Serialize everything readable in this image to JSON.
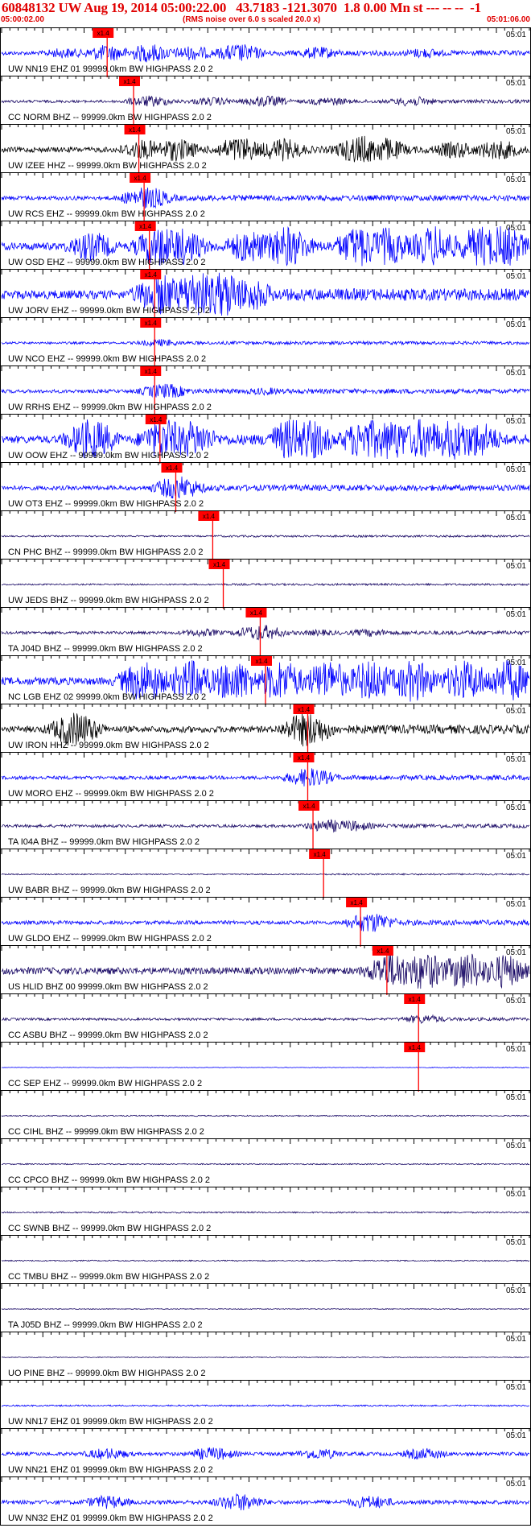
{
  "header": {
    "title": "60848132 UW Aug 19, 2014 05:00:22.00   43.7183 -121.3070  1.8 0.00 Mn st --- -- --  -1",
    "start_time": "05:00:02.00",
    "rms_note": "(RMS noise over 6.0 s scaled 20.0 x)",
    "end_time": "05:01:06.00"
  },
  "colors": {
    "trace_blue": "#0000ff",
    "trace_navy": "#1a0a66",
    "trace_black": "#000000",
    "pick_red": "#ff0000",
    "title_red": "#e00000"
  },
  "chart_data": {
    "type": "seismogram",
    "x_start": "05:00:02.00",
    "x_end": "05:01:06.00",
    "minute_label": "05:01",
    "pick_label": "x1.4",
    "panels": [
      {
        "label": "UW NN19 EHZ 01 99999.0km BW  HIGHPASS  2.0  2",
        "color": "blue",
        "pick": 0.2,
        "env": [
          [
            0.12,
            0.5
          ],
          [
            0.2,
            0.8
          ],
          [
            0.28,
            0.9
          ],
          [
            0.36,
            0.7
          ],
          [
            0.45,
            0.9
          ],
          [
            0.6,
            0.6
          ],
          [
            0.8,
            0.5
          ]
        ],
        "amp": 13
      },
      {
        "label": "CC NORM BHZ -- 99999.0km BW  HIGHPASS  2.0  2",
        "color": "navy",
        "pick": 0.25,
        "env": [
          [
            0.28,
            0.8
          ],
          [
            0.4,
            0.6
          ],
          [
            0.5,
            0.8
          ],
          [
            0.62,
            0.6
          ],
          [
            0.78,
            0.7
          ]
        ],
        "amp": 9
      },
      {
        "label": "UW IZEE HHZ -- 99999.0km BW  HIGHPASS  2.0  2",
        "color": "black",
        "pick": 0.26,
        "env": [
          [
            0.27,
            0.7
          ],
          [
            0.33,
            0.8
          ],
          [
            0.45,
            0.9
          ],
          [
            0.53,
            0.8
          ],
          [
            0.68,
            1.0
          ],
          [
            0.72,
            0.9
          ],
          [
            0.86,
            0.6
          ],
          [
            0.94,
            0.7
          ]
        ],
        "amp": 18
      },
      {
        "label": "UW RCS EHZ -- 99999.0km BW  HIGHPASS  2.0  2",
        "color": "blue",
        "pick": 0.27,
        "env": [
          [
            0.275,
            1.0
          ]
        ],
        "amp": 14
      },
      {
        "label": "UW OSD EHZ -- 99999.0km BW  HIGHPASS  2.0  2",
        "color": "blue",
        "pick": 0.28,
        "env": [
          [
            0.17,
            0.7
          ],
          [
            0.3,
            1.0
          ],
          [
            0.34,
            0.9
          ],
          [
            0.47,
            0.8
          ],
          [
            0.54,
            1.0
          ],
          [
            0.68,
            1.0
          ],
          [
            0.73,
            0.9
          ],
          [
            0.82,
            1.0
          ],
          [
            0.91,
            1.0
          ],
          [
            0.95,
            1.0
          ]
        ],
        "amp": 26
      },
      {
        "label": "UW JORV EHZ -- 99999.0km BW  HIGHPASS  2.0  2",
        "color": "blue",
        "pick": 0.29,
        "env": [
          [
            0.3,
            0.9
          ],
          [
            0.37,
            1.0
          ],
          [
            0.42,
            1.0
          ],
          [
            0.47,
            0.7
          ]
        ],
        "amp": 30
      },
      {
        "label": "UW NCO EHZ -- 99999.0km BW  HIGHPASS  2.0  2",
        "color": "blue",
        "pick": 0.29,
        "env": [
          [
            0.3,
            0.6
          ]
        ],
        "amp": 8
      },
      {
        "label": "UW RRHS EHZ -- 99999.0km BW  HIGHPASS  2.0  2",
        "color": "blue",
        "pick": 0.29,
        "env": [
          [
            0.31,
            0.8
          ],
          [
            0.5,
            0.4
          ]
        ],
        "amp": 12
      },
      {
        "label": "UW OOW EHZ -- 99999.0km BW  HIGHPASS  2.0  2",
        "color": "blue",
        "pick": 0.3,
        "env": [
          [
            0.17,
            1.0
          ],
          [
            0.31,
            1.0
          ],
          [
            0.36,
            0.9
          ],
          [
            0.55,
            1.0
          ],
          [
            0.58,
            1.0
          ],
          [
            0.69,
            1.0
          ],
          [
            0.74,
            1.0
          ],
          [
            0.8,
            1.0
          ],
          [
            0.86,
            1.0
          ],
          [
            0.9,
            0.9
          ]
        ],
        "amp": 26
      },
      {
        "label": "UW OT3 EHZ -- 99999.0km BW  HIGHPASS  2.0  2",
        "color": "blue",
        "pick": 0.33,
        "env": [
          [
            0.335,
            1.0
          ]
        ],
        "amp": 15
      },
      {
        "label": "CN PHC BHZ -- 99999.0km BW  HIGHPASS  2.0  2",
        "color": "navy",
        "pick": 0.4,
        "env": [],
        "amp": 5
      },
      {
        "label": "UW JEDS BHZ -- 99999.0km BW  HIGHPASS  2.0  2",
        "color": "navy",
        "pick": 0.42,
        "env": [],
        "amp": 5
      },
      {
        "label": "TA J04D BHZ -- 99999.0km BW  HIGHPASS  2.0  2",
        "color": "navy",
        "pick": 0.49,
        "env": [
          [
            0.49,
            1.0
          ],
          [
            0.38,
            0.5
          ],
          [
            0.6,
            0.4
          ],
          [
            0.7,
            0.5
          ]
        ],
        "amp": 10
      },
      {
        "label": "NC LGB EHZ 02 99999.0km BW  HIGHPASS  2.0  2",
        "color": "blue",
        "pick": 0.5,
        "env": [
          [
            0.27,
            1.0
          ],
          [
            0.36,
            1.0
          ],
          [
            0.44,
            1.0
          ],
          [
            0.53,
            1.0
          ],
          [
            0.62,
            1.0
          ],
          [
            0.7,
            1.0
          ],
          [
            0.78,
            1.0
          ],
          [
            0.88,
            1.0
          ],
          [
            0.96,
            1.0
          ]
        ],
        "amp": 26
      },
      {
        "label": "UW IRON HHZ -- 99999.0km BW  HIGHPASS  2.0  2",
        "color": "black",
        "pick": 0.58,
        "env": [
          [
            0.14,
            1.0
          ],
          [
            0.58,
            1.0
          ]
        ],
        "amp": 22
      },
      {
        "label": "UW MORO EHZ -- 99999.0km BW  HIGHPASS  2.0  2",
        "color": "blue",
        "pick": 0.58,
        "env": [
          [
            0.585,
            1.0
          ]
        ],
        "amp": 12
      },
      {
        "label": "TA I04A BHZ -- 99999.0km BW  HIGHPASS  2.0  2",
        "color": "navy",
        "pick": 0.59,
        "env": [
          [
            0.62,
            0.8
          ],
          [
            0.66,
            0.7
          ]
        ],
        "amp": 10
      },
      {
        "label": "UW BABR BHZ -- 99999.0km BW  HIGHPASS  2.0  2",
        "color": "navy",
        "pick": 0.61,
        "env": [],
        "amp": 4
      },
      {
        "label": "UW GLDO EHZ -- 99999.0km BW  HIGHPASS  2.0  2",
        "color": "blue",
        "pick": 0.68,
        "env": [
          [
            0.7,
            1.0
          ]
        ],
        "amp": 13
      },
      {
        "label": "US HLID BHZ 00 99999.0km BW  HIGHPASS  2.0  2",
        "color": "navy",
        "pick": 0.73,
        "env": [
          [
            0.74,
            1.0
          ],
          [
            0.8,
            1.0
          ],
          [
            0.88,
            1.0
          ],
          [
            0.95,
            0.9
          ]
        ],
        "amp": 24
      },
      {
        "label": "CC ASBU BHZ -- 99999.0km BW  HIGHPASS  2.0  2",
        "color": "navy",
        "pick": 0.79,
        "env": [
          [
            0.8,
            0.7
          ]
        ],
        "amp": 8
      },
      {
        "label": "CC SEP EHZ -- 99999.0km BW  HIGHPASS  2.0  2",
        "color": "blue",
        "pick": 0.79,
        "env": [],
        "amp": 2
      },
      {
        "label": "CC CIHL BHZ -- 99999.0km BW  HIGHPASS  2.0  2",
        "color": "navy",
        "pick": null,
        "env": [],
        "amp": 4
      },
      {
        "label": "CC CPCO BHZ -- 99999.0km BW  HIGHPASS  2.0  2",
        "color": "navy",
        "pick": null,
        "env": [],
        "amp": 4
      },
      {
        "label": "CC SWNB BHZ -- 99999.0km BW  HIGHPASS  2.0  2",
        "color": "navy",
        "pick": null,
        "env": [],
        "amp": 5
      },
      {
        "label": "CC TMBU BHZ -- 99999.0km BW  HIGHPASS  2.0  2",
        "color": "navy",
        "pick": null,
        "env": [],
        "amp": 4
      },
      {
        "label": "TA J05D BHZ -- 99999.0km BW  HIGHPASS  2.0  2",
        "color": "navy",
        "pick": null,
        "env": [],
        "amp": 3
      },
      {
        "label": "UO PINE BHZ -- 99999.0km BW  HIGHPASS  2.0  2",
        "color": "navy",
        "pick": null,
        "env": [],
        "amp": 3
      },
      {
        "label": "UW NN17 EHZ 01 99999.0km BW  HIGHPASS  2.0  2",
        "color": "blue",
        "pick": null,
        "env": [],
        "amp": 5
      },
      {
        "label": "UW NN21 EHZ 01 99999.0km BW  HIGHPASS  2.0  2",
        "color": "blue",
        "pick": null,
        "env": [
          [
            0.2,
            0.6
          ],
          [
            0.4,
            0.7
          ],
          [
            0.6,
            0.6
          ],
          [
            0.8,
            0.6
          ]
        ],
        "amp": 12
      },
      {
        "label": "UW NN32 EHZ 01 99999.0km BW  HIGHPASS  2.0  2",
        "color": "blue",
        "pick": null,
        "env": [
          [
            0.2,
            0.6
          ],
          [
            0.45,
            0.8
          ],
          [
            0.7,
            0.6
          ]
        ],
        "amp": 14
      }
    ]
  }
}
